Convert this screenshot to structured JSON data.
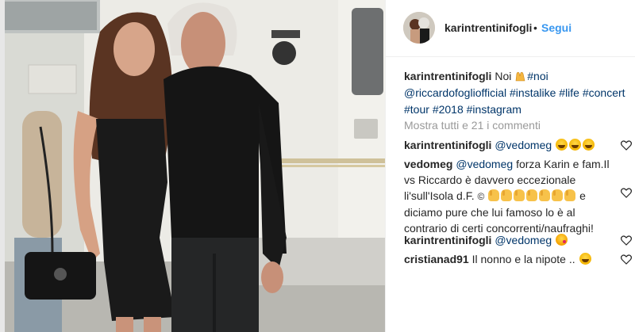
{
  "post": {
    "header": {
      "username": "karintrentinifogli",
      "separator": "•",
      "follow_label": "Segui"
    },
    "caption": {
      "username": "karintrentinifogli",
      "text": "Noi",
      "emoji": "raised-hands-emoji",
      "hashtag_noi": "#noi",
      "mention": "@riccardofogliofficial",
      "tags": [
        "#instalike",
        "#life",
        "#concert",
        "#tour",
        "#2018",
        "#instagram"
      ]
    },
    "more_comments_label": "Mostra tutti e 21 i commenti",
    "comments": [
      {
        "username": "karintrentinifogli",
        "mention": "@vedomeg",
        "emojis": [
          "laughing-emoji",
          "laughing-emoji",
          "laughing-emoji"
        ]
      },
      {
        "username": "vedomeg",
        "mention": "@vedomeg",
        "text_1": "forza Karin e fam.Il vs Riccardo è davvero eccezionale li'sull'Isola d.F.",
        "copyright": "©",
        "text_2": "e diciamo pure che lui famoso lo è al contrario di certi concorrenti/naufraghi!"
      },
      {
        "username": "karintrentinifogli",
        "mention": "@vedomeg",
        "emojis": [
          "kissing-emoji"
        ]
      },
      {
        "username": "cristianad91",
        "text": "Il nonno e la nipote ..",
        "emojis": [
          "laughing-emoji"
        ]
      }
    ]
  },
  "colors": {
    "link": "#003569",
    "follow": "#3897f0",
    "muted": "#999999",
    "text": "#262626"
  }
}
